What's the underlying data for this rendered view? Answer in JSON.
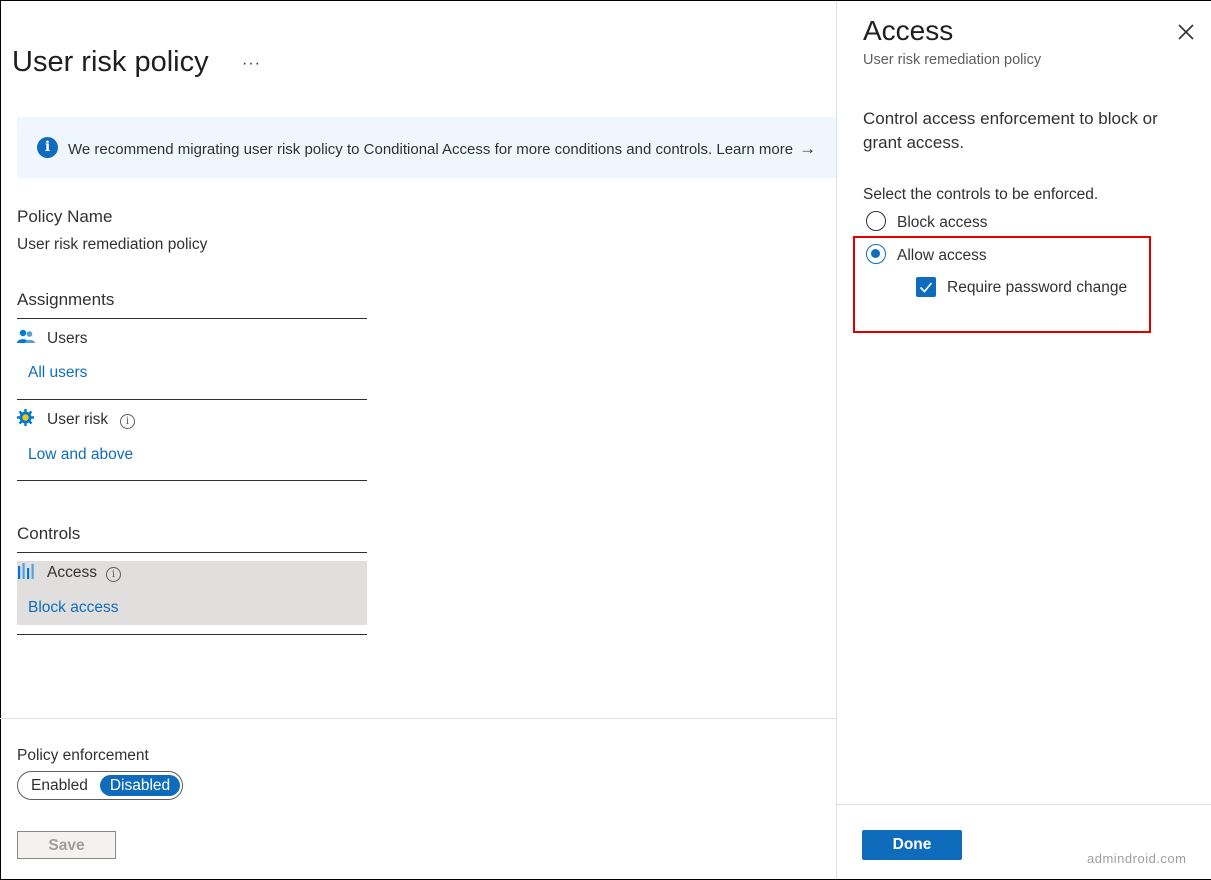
{
  "page": {
    "title": "User risk policy",
    "more_label": "···"
  },
  "banner": {
    "text": "We recommend migrating user risk policy to Conditional Access for more conditions and controls.",
    "link": "Learn more",
    "arrow": "→"
  },
  "policy_name": {
    "label": "Policy Name",
    "value": "User risk remediation policy"
  },
  "assignments": {
    "heading": "Assignments",
    "users_label": "Users",
    "users_value": "All users",
    "user_risk_label": "User risk",
    "user_risk_value": "Low and above"
  },
  "controls": {
    "heading": "Controls",
    "access_label": "Access",
    "access_value": "Block access"
  },
  "enforcement": {
    "label": "Policy enforcement",
    "enabled": "Enabled",
    "disabled": "Disabled",
    "selected": "Disabled"
  },
  "save_label": "Save",
  "panel": {
    "title": "Access",
    "subtitle": "User risk remediation policy",
    "description": "Control access enforcement to block or grant access.",
    "prompt": "Select the controls to be enforced.",
    "options": [
      {
        "label": "Block access",
        "checked": false
      },
      {
        "label": "Allow access",
        "checked": true
      }
    ],
    "require_password_change": "Require password change",
    "done_label": "Done"
  },
  "watermark": "admindroid.com",
  "colors": {
    "accent": "#0f6cbd",
    "highlight": "#e00000",
    "banner_bg": "#f0f6fd",
    "selected_row_bg": "#e1dfdd"
  },
  "icons": {
    "info": "info-icon",
    "users": "users-icon",
    "user_risk": "gear-icon",
    "access": "access-bars-icon",
    "close": "close-icon",
    "check": "check-icon"
  }
}
